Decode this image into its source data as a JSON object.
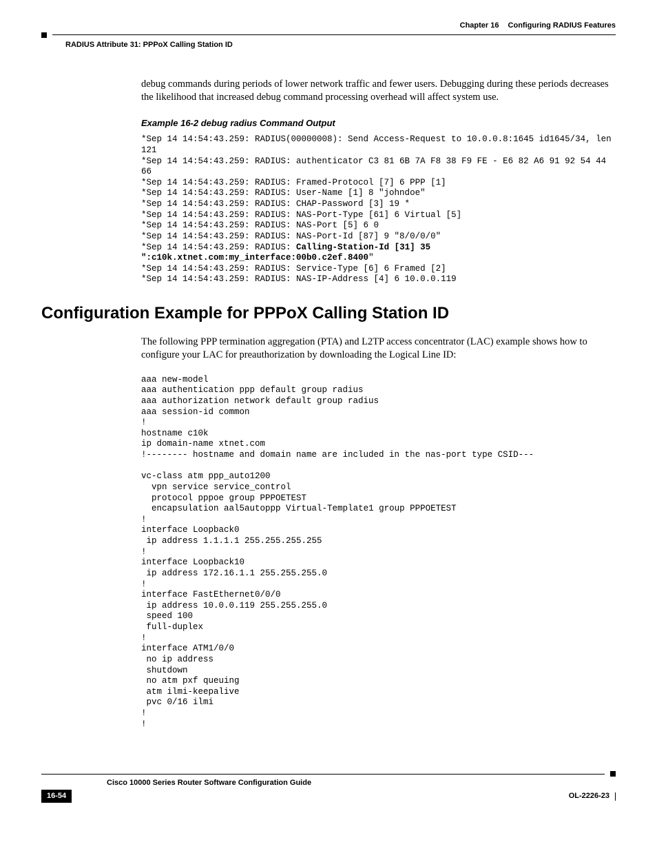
{
  "header": {
    "chapter_label": "Chapter 16",
    "chapter_title": "Configuring RADIUS Features",
    "breadcrumb": "RADIUS Attribute 31: PPPoX Calling Station ID"
  },
  "intro_para": "debug commands during periods of lower network traffic and fewer users. Debugging during these periods decreases the likelihood that increased debug command processing overhead will affect system use.",
  "example": {
    "title": "Example 16-2   debug radius Command Output",
    "pre_bold": "*Sep 14 14:54:43.259: RADIUS(00000008): Send Access-Request to 10.0.0.8:1645 id1645/34, len 121\n*Sep 14 14:54:43.259: RADIUS: authenticator C3 81 6B 7A F8 38 F9 FE - E6 82 A6 91 92 54 44 66\n*Sep 14 14:54:43.259: RADIUS: Framed-Protocol [7] 6 PPP [1]\n*Sep 14 14:54:43.259: RADIUS: User-Name [1] 8 \"johndoe\"\n*Sep 14 14:54:43.259: RADIUS: CHAP-Password [3] 19 *\n*Sep 14 14:54:43.259: RADIUS: NAS-Port-Type [61] 6 Virtual [5]\n*Sep 14 14:54:43.259: RADIUS: NAS-Port [5] 6 0\n*Sep 14 14:54:43.259: RADIUS: NAS-Port-Id [87] 9 \"8/0/0/0\"\n*Sep 14 14:54:43.259: RADIUS: ",
    "bold_part": "Calling-Station-Id [31] 35 \":c10k.xtnet.com:my_interface:00b0.c2ef.8400",
    "post_bold": "\"\n*Sep 14 14:54:43.259: RADIUS: Service-Type [6] 6 Framed [2]\n*Sep 14 14:54:43.259: RADIUS: NAS-IP-Address [4] 6 10.0.0.119"
  },
  "section": {
    "heading": "Configuration Example for PPPoX Calling Station ID",
    "para": "The following PPP termination aggregation (PTA) and L2TP access concentrator (LAC) example shows how to configure your LAC for preauthorization by downloading the Logical Line ID:",
    "code": "aaa new-model\naaa authentication ppp default group radius\naaa authorization network default group radius\naaa session-id common\n!\nhostname c10k\nip domain-name xtnet.com\n!-------- hostname and domain name are included in the nas-port type CSID---\n\nvc-class atm ppp_auto1200\n  vpn service service_control\n  protocol pppoe group PPPOETEST\n  encapsulation aal5autoppp Virtual-Template1 group PPPOETEST\n!\ninterface Loopback0\n ip address 1.1.1.1 255.255.255.255\n!\ninterface Loopback10\n ip address 172.16.1.1 255.255.255.0\n!\ninterface FastEthernet0/0/0\n ip address 10.0.0.119 255.255.255.0\n speed 100\n full-duplex\n!\ninterface ATM1/0/0\n no ip address\n shutdown\n no atm pxf queuing\n atm ilmi-keepalive\n pvc 0/16 ilmi\n!\n!"
  },
  "footer": {
    "guide_title": "Cisco 10000 Series Router Software Configuration Guide",
    "page": "16-54",
    "doc_id": "OL-2226-23"
  }
}
